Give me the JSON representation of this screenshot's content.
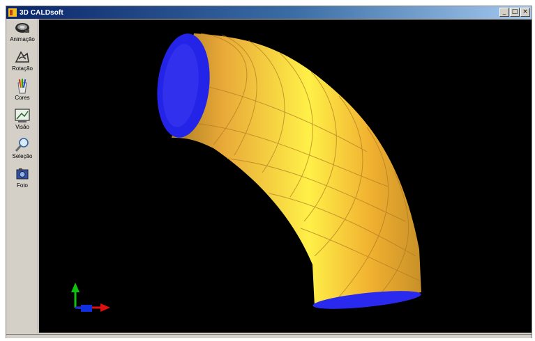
{
  "window": {
    "title": "3D CALDsoft",
    "minimize_glyph": "_",
    "maximize_glyph": "□",
    "close_glyph": "×"
  },
  "toolbar": {
    "items": [
      {
        "label": "Animação",
        "icon": "animation-icon"
      },
      {
        "label": "Rotação",
        "icon": "rotation-icon"
      },
      {
        "label": "Cores",
        "icon": "colors-icon"
      },
      {
        "label": "Visão",
        "icon": "view-icon"
      },
      {
        "label": "Seleção",
        "icon": "selection-icon"
      },
      {
        "label": "Foto",
        "icon": "photo-icon"
      }
    ]
  },
  "viewport": {
    "background": "#000000",
    "model_color": "#f0b030",
    "model_highlight": "#fff040",
    "end_cap_color": "#2a2aee",
    "axes": {
      "x_color": "#e01010",
      "y_color": "#10c010",
      "z_color": "#1030e0"
    }
  }
}
